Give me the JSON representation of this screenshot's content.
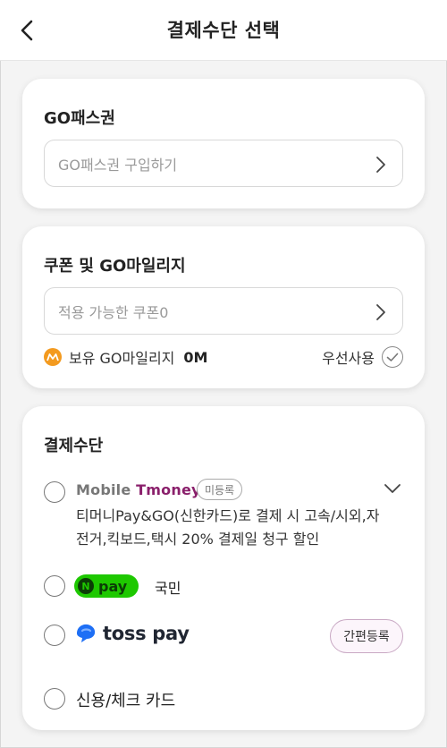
{
  "header": {
    "title": "결제수단 선택",
    "back_icon": "chevron-left-icon"
  },
  "gopass": {
    "title": "GO패스권",
    "field_placeholder": "GO패스권 구입하기",
    "chevron_icon": "chevron-right-icon"
  },
  "coupon": {
    "title": "쿠폰 및 GO마일리지",
    "field_placeholder": "적용 가능한 쿠폰0",
    "chevron_icon": "chevron-right-icon",
    "mileage_label": "보유 GO마일리지",
    "mileage_amount": "0M",
    "priority_label": "우선사용",
    "coin_icon": "mileage-coin-icon",
    "check_icon": "check-circle-icon"
  },
  "payment": {
    "title": "결제수단",
    "methods": [
      {
        "logo_text_a": "Mobile",
        "logo_text_b": "Tmoney",
        "badge": "미등록",
        "description": "티머니Pay&GO(신한카드)로 결제 시 고속/시외,자전거,킥보드,택시 20% 결제일 청구 할인",
        "expand_icon": "chevron-down-icon",
        "selected": false
      },
      {
        "logo_text": "pay",
        "logo_badge": "N",
        "bank": "국민",
        "selected": false
      },
      {
        "logo_text": "toss pay",
        "action": "간편등록",
        "selected": false
      },
      {
        "label": "신용/체크 카드",
        "selected": false
      }
    ]
  },
  "colors": {
    "accent_purple": "#8a1f6b",
    "npay_green": "#1ec800",
    "toss_blue": "#1e6ff5",
    "mileage_orange": "#f39a1f"
  }
}
